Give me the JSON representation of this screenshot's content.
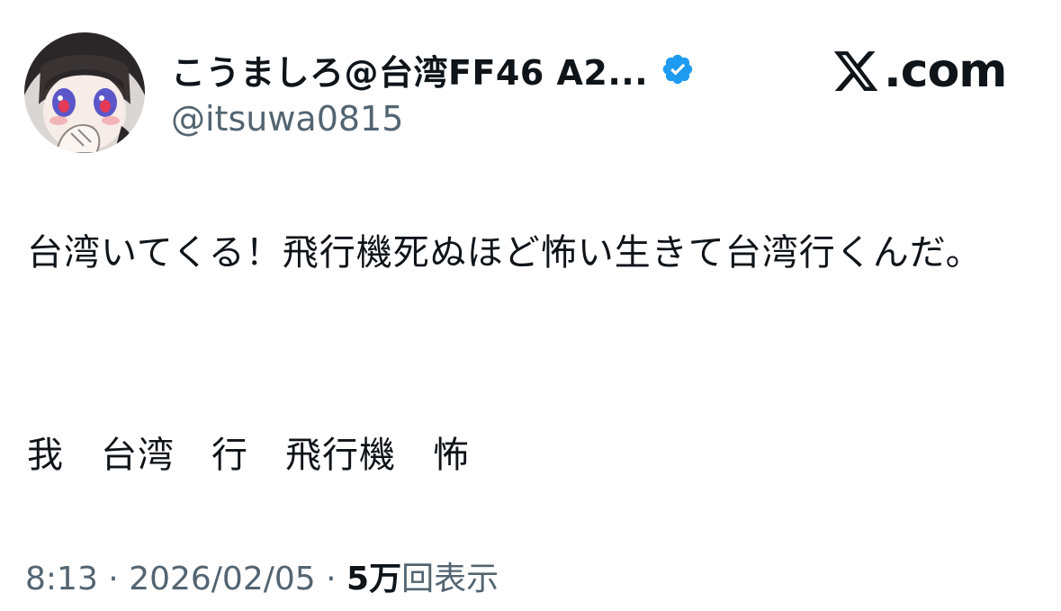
{
  "author": {
    "display_name": "こうましろ@台湾FF46 A2...",
    "handle": "@itsuwa0815",
    "verified": true,
    "verified_color": "#1d9bf0"
  },
  "brand": {
    "icon": "x-logo-icon",
    "text": ".com"
  },
  "tweet": {
    "text": "台湾いてくる！飛行機死ぬほど怖い生きて台湾行くんだ。",
    "keywords": "我　台湾　行　飛行機　怖"
  },
  "meta": {
    "time": "8:13",
    "separator": " · ",
    "date": "2026/02/05",
    "views_count": "5万",
    "views_label": "回表示"
  },
  "colors": {
    "text": "#0f1419",
    "secondary": "#536471",
    "background": "#ffffff"
  }
}
